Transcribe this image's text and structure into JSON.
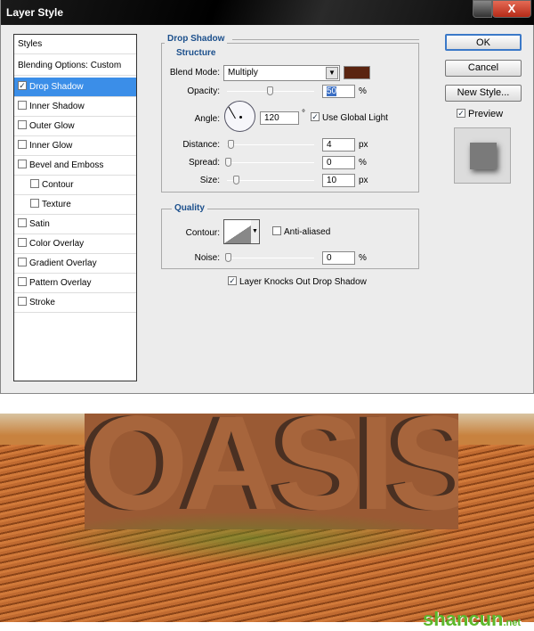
{
  "window": {
    "title": "Layer Style",
    "close": "X"
  },
  "styles_panel": {
    "header": "Styles",
    "blending": "Blending Options: Custom",
    "items": [
      {
        "label": "Drop Shadow",
        "checked": true,
        "selected": true
      },
      {
        "label": "Inner Shadow",
        "checked": false
      },
      {
        "label": "Outer Glow",
        "checked": false
      },
      {
        "label": "Inner Glow",
        "checked": false
      },
      {
        "label": "Bevel and Emboss",
        "checked": false
      },
      {
        "label": "Contour",
        "checked": false,
        "indent": true
      },
      {
        "label": "Texture",
        "checked": false,
        "indent": true
      },
      {
        "label": "Satin",
        "checked": false
      },
      {
        "label": "Color Overlay",
        "checked": false
      },
      {
        "label": "Gradient Overlay",
        "checked": false
      },
      {
        "label": "Pattern Overlay",
        "checked": false
      },
      {
        "label": "Stroke",
        "checked": false
      }
    ]
  },
  "drop_shadow": {
    "title": "Drop Shadow",
    "structure": "Structure",
    "blend_mode_label": "Blend Mode:",
    "blend_mode": "Multiply",
    "shadow_color": "#5a2410",
    "opacity_label": "Opacity:",
    "opacity": "50",
    "opacity_unit": "%",
    "angle_label": "Angle:",
    "angle": "120",
    "angle_unit": "°",
    "use_global_light": "Use Global Light",
    "distance_label": "Distance:",
    "distance": "4",
    "distance_unit": "px",
    "spread_label": "Spread:",
    "spread": "0",
    "spread_unit": "%",
    "size_label": "Size:",
    "size": "10",
    "size_unit": "px",
    "quality": "Quality",
    "contour_label": "Contour:",
    "anti_aliased": "Anti-aliased",
    "noise_label": "Noise:",
    "noise": "0",
    "noise_unit": "%",
    "knockout": "Layer Knocks Out Drop Shadow"
  },
  "buttons": {
    "ok": "OK",
    "cancel": "Cancel",
    "new_style": "New Style...",
    "preview": "Preview"
  },
  "photo": {
    "text": "OASIS",
    "watermark": "shancun.net"
  }
}
